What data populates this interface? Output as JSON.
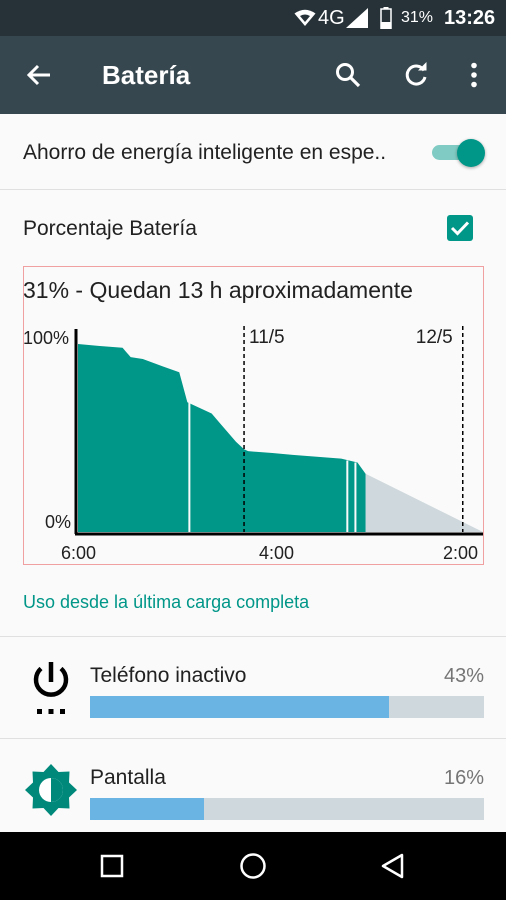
{
  "status_bar": {
    "network": "4G",
    "battery_percent": "31%",
    "time": "13:26",
    "icons": [
      "wifi-icon",
      "cell-signal-icon",
      "battery-icon"
    ]
  },
  "app_bar": {
    "title": "Batería",
    "icons": [
      "back-arrow-icon",
      "search-icon",
      "refresh-icon",
      "more-vert-icon"
    ]
  },
  "settings": {
    "smart_saving_label": "Ahorro de energía inteligente en espe..",
    "smart_saving_enabled": true,
    "percentage_label": "Porcentaje Batería",
    "percentage_checked": true
  },
  "chart_data": {
    "type": "area",
    "title": "31% - Quedan 13 h aproximadamente",
    "y_tick_labels": [
      "100%",
      "0%"
    ],
    "x_tick_labels": [
      "6:00",
      "4:00",
      "2:00"
    ],
    "date_markers": [
      "11/5",
      "12/5"
    ],
    "ylim": [
      0,
      100
    ],
    "series": [
      {
        "values": [
          {
            "x": 0.0,
            "y": 100
          },
          {
            "x": 0.05,
            "y": 99
          },
          {
            "x": 0.11,
            "y": 98
          },
          {
            "x": 0.13,
            "y": 93
          },
          {
            "x": 0.16,
            "y": 92
          },
          {
            "x": 0.21,
            "y": 88
          },
          {
            "x": 0.25,
            "y": 85
          },
          {
            "x": 0.27,
            "y": 69
          },
          {
            "x": 0.31,
            "y": 65
          },
          {
            "x": 0.33,
            "y": 63
          },
          {
            "x": 0.35,
            "y": 58
          },
          {
            "x": 0.39,
            "y": 48
          },
          {
            "x": 0.41,
            "y": 44
          },
          {
            "x": 0.42,
            "y": 43
          },
          {
            "x": 0.48,
            "y": 42
          },
          {
            "x": 0.53,
            "y": 41
          },
          {
            "x": 0.65,
            "y": 39
          },
          {
            "x": 0.69,
            "y": 37
          },
          {
            "x": 0.71,
            "y": 31
          }
        ]
      }
    ],
    "projection": {
      "x_start": 0.71,
      "y_start": 31,
      "x_end": 1.0,
      "y_end": 0
    },
    "colors": {
      "fill": "#009688",
      "projection": "#cfd8dc",
      "axis": "#000000"
    }
  },
  "usage": {
    "section_title": "Uso desde la última carga completa",
    "items": [
      {
        "label": "Teléfono inactivo",
        "percent_text": "43%",
        "fill_fraction": 0.76,
        "icon": "power-icon"
      },
      {
        "label": "Pantalla",
        "percent_text": "16%",
        "fill_fraction": 0.29,
        "icon": "brightness-icon"
      }
    ]
  },
  "nav_bar": {
    "icons": [
      "recents-square-icon",
      "home-circle-icon",
      "back-triangle-icon"
    ]
  },
  "colors": {
    "accent": "#009688",
    "app_bar": "#37474f",
    "status_bar": "#263238",
    "usage_fill": "#6ab4e3"
  }
}
